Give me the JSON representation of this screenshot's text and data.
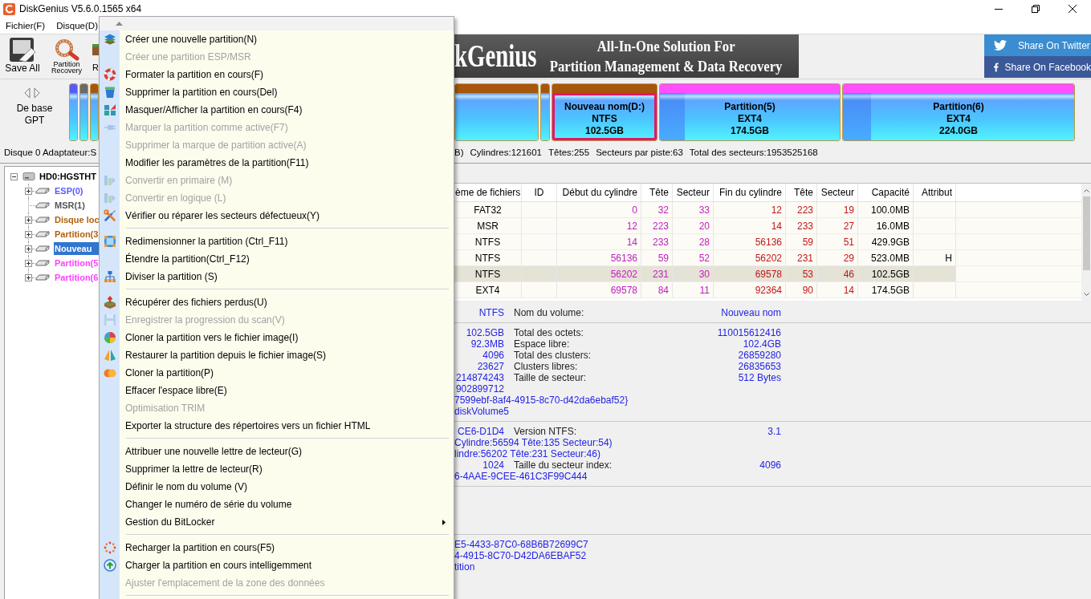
{
  "window": {
    "title": "DiskGenius V5.6.0.1565 x64"
  },
  "menu_bar": [
    "Fichier(F)",
    "Disque(D)"
  ],
  "toolbar": [
    "Save All",
    "Partition Recovery",
    "R"
  ],
  "banner": {
    "logo": "kGenius",
    "tagline": [
      "All-In-One Solution For",
      "Partition Management & Data Recovery"
    ]
  },
  "share_buttons": [
    "Share On Twitter",
    "Share On Facebook"
  ],
  "disk_map": {
    "disk_type": [
      "De base",
      "GPT"
    ],
    "partitions": [
      {
        "color": "#5a5af0",
        "selected": false
      },
      {
        "color": "#6a6a6a",
        "selected": false
      },
      {
        "color": "#a8560c",
        "selected": false
      },
      {
        "color": "#a8560c",
        "selected": false
      },
      {
        "color": "#a8560c",
        "selected": false
      },
      {
        "name": "Nouveau nom(D:)",
        "file_system": "NTFS",
        "size": "102.5GB",
        "color": "#a8560c",
        "selected": true
      },
      {
        "name": "Partition(5)",
        "file_system": "EXT4",
        "size": "174.5GB",
        "color": "#ff50ff",
        "selected": false,
        "level": 0.14
      },
      {
        "name": "Partition(6)",
        "file_system": "EXT4",
        "size": "224.0GB",
        "color": "#ff50ff",
        "selected": false,
        "level": 0.12
      }
    ]
  },
  "disk_info": [
    "Disque 0 Adaptateur:S",
    "B)",
    "Cylindres:121601",
    "Têtes:255",
    "Secteurs par piste:63",
    "Total des secteurs:1953525168"
  ],
  "tree": {
    "label": "HD0:HGSTHT",
    "expanded": true,
    "children": [
      {
        "label": "ESP(0)",
        "color": "#5a5aff",
        "expandable": true,
        "selected": false
      },
      {
        "label": "MSR(1)",
        "color": "#555555",
        "expandable": false,
        "selected": false
      },
      {
        "label": "Disque loc",
        "color": "#b4600a",
        "expandable": true,
        "selected": false
      },
      {
        "label": "Partition(3",
        "color": "#b4600a",
        "expandable": true,
        "selected": false
      },
      {
        "label": "Nouveau",
        "expandable": true,
        "selected": true
      },
      {
        "label": "Partition(5",
        "color": "#ff40ff",
        "expandable": true,
        "selected": false
      },
      {
        "label": "Partition(6",
        "color": "#ff40ff",
        "expandable": true,
        "selected": false
      }
    ]
  },
  "partition_table": {
    "columns": [
      "ème de fichiers",
      "ID",
      "Début du cylindre",
      "Tête",
      "Secteur",
      "Fin du cylindre",
      "Tête",
      "Secteur",
      "Capacité",
      "Attribut"
    ],
    "rows": [
      {
        "file_system": "FAT32",
        "start_cylinder": "0",
        "start_head": "32",
        "start_sector": "33",
        "end_cylinder": "12",
        "end_head": "223",
        "end_sector": "19",
        "capacity": "100.0MB",
        "selected": false
      },
      {
        "file_system": "MSR",
        "start_cylinder": "12",
        "start_head": "223",
        "start_sector": "20",
        "end_cylinder": "14",
        "end_head": "233",
        "end_sector": "27",
        "capacity": "16.0MB",
        "selected": false
      },
      {
        "file_system": "NTFS",
        "start_cylinder": "14",
        "start_head": "233",
        "start_sector": "28",
        "end_cylinder": "56136",
        "end_head": "59",
        "end_sector": "51",
        "capacity": "429.9GB",
        "selected": false
      },
      {
        "file_system": "NTFS",
        "start_cylinder": "56136",
        "start_head": "59",
        "start_sector": "52",
        "end_cylinder": "56202",
        "end_head": "231",
        "end_sector": "29",
        "capacity": "523.0MB",
        "attribute": "H",
        "selected": false
      },
      {
        "file_system": "NTFS",
        "start_cylinder": "56202",
        "start_head": "231",
        "start_sector": "30",
        "end_cylinder": "69578",
        "end_head": "53",
        "end_sector": "46",
        "capacity": "102.5GB",
        "selected": true
      },
      {
        "file_system": "EXT4",
        "start_cylinder": "69578",
        "start_head": "84",
        "start_sector": "11",
        "end_cylinder": "92364",
        "end_head": "90",
        "end_sector": "14",
        "capacity": "174.5GB",
        "selected": false
      }
    ]
  },
  "details": {
    "sections": [
      {
        "kind": "rows",
        "rows": [
          {
            "kind": "pair",
            "left_value": "NTFS",
            "label": "Nom du volume:",
            "value": "Nouveau nom"
          }
        ]
      },
      {
        "kind": "rows",
        "rows": [
          {
            "kind": "pair",
            "left_value": "102.5GB",
            "label": "Total des octets:",
            "value": "110015612416"
          },
          {
            "kind": "pair",
            "left_value": "92.3MB",
            "label": "Espace libre:",
            "value": "102.4GB"
          },
          {
            "kind": "pair",
            "left_value": "4096",
            "label": "Total des clusters:",
            "value": "26859280"
          },
          {
            "kind": "pair",
            "left_value": "23627",
            "label": "Clusters libres:",
            "value": "26835653"
          },
          {
            "kind": "pair",
            "left_value": "214874243",
            "label": "Taille de secteur:",
            "value": "512 Bytes"
          },
          {
            "kind": "pair",
            "left_value": "902899712"
          },
          {
            "kind": "line",
            "text": "7599ebf-8af4-4915-8c70-d42da6ebaf52}"
          },
          {
            "kind": "line",
            "text": "diskVolume5"
          }
        ]
      },
      {
        "kind": "rows",
        "rows": [
          {
            "kind": "pair",
            "left_value": "CE6-D1D4",
            "label": "Version NTFS:",
            "value": "3.1"
          },
          {
            "kind": "line",
            "text": "Cylindre:56594 Tête:135 Secteur:54)"
          },
          {
            "kind": "line",
            "text": "lindre:56202 Tête:231 Secteur:46)"
          },
          {
            "kind": "pair",
            "left_value": "1024",
            "label": "Taille du secteur index:",
            "value": "4096"
          },
          {
            "kind": "line",
            "text": "6-4AAE-9CEE-461C3F99C444"
          }
        ]
      },
      {
        "kind": "blank"
      },
      {
        "kind": "rows",
        "rows": [
          {
            "kind": "line",
            "text": "E5-4433-87C0-68B6B72699C7"
          },
          {
            "kind": "line",
            "text": "4-4915-8C70-D42DA6EBAF52"
          },
          {
            "kind": "line",
            "text": "tition"
          }
        ]
      }
    ]
  },
  "context_menu": {
    "groups": [
      {
        "items": [
          {
            "label": "Créer une nouvelle partition(N)",
            "disabled": false
          },
          {
            "label": "Créer une partition ESP/MSR",
            "disabled": true
          },
          {
            "label": "Formater la partition en cours(F)",
            "disabled": false
          },
          {
            "label": "Supprimer la partition en cours(Del)",
            "disabled": false
          },
          {
            "label": "Masquer/Afficher la partition en cours(F4)",
            "disabled": false
          },
          {
            "label": "Marquer la partition comme active(F7)",
            "disabled": true
          },
          {
            "label": "Supprimer la marque de partition active(A)",
            "disabled": true
          },
          {
            "label": "Modifier les paramètres de la partition(F11)",
            "disabled": false
          },
          {
            "label": "Convertir en primaire (M)",
            "disabled": true
          },
          {
            "label": "Convertir en logique (L)",
            "disabled": true
          },
          {
            "label": "Vérifier ou réparer les secteurs défectueux(Y)",
            "disabled": false
          }
        ]
      },
      {
        "items": [
          {
            "label": "Redimensionner la partition (Ctrl_F11)",
            "disabled": false
          },
          {
            "label": "Étendre la partition(Ctrl_F12)",
            "disabled": false
          },
          {
            "label": "Diviser la partition (S)",
            "disabled": false
          }
        ]
      },
      {
        "items": [
          {
            "label": "Récupérer des fichiers perdus(U)",
            "disabled": false
          },
          {
            "label": "Enregistrer la progression du scan(V)",
            "disabled": true
          },
          {
            "label": "Cloner la partition vers le fichier image(I)",
            "disabled": false
          },
          {
            "label": "Restaurer la partition depuis le fichier image(S)",
            "disabled": false
          },
          {
            "label": "Cloner la partition(P)",
            "disabled": false
          },
          {
            "label": "Effacer l'espace libre(E)",
            "disabled": false
          },
          {
            "label": "Optimisation TRIM",
            "disabled": true
          },
          {
            "label": "Exporter la structure des répertoires vers un fichier HTML",
            "disabled": false
          }
        ]
      },
      {
        "items": [
          {
            "label": "Attribuer une nouvelle lettre de lecteur(G)",
            "disabled": false
          },
          {
            "label": "Supprimer la lettre de lecteur(R)",
            "disabled": false
          },
          {
            "label": "Définir le nom du volume (V)",
            "disabled": false
          },
          {
            "label": "Changer le numéro de série du volume",
            "disabled": false
          },
          {
            "label": "Gestion du BitLocker",
            "disabled": false,
            "submenu": true
          }
        ]
      },
      {
        "items": [
          {
            "label": "Recharger la partition en cours(F5)",
            "disabled": false
          },
          {
            "label": "Charger la partition en cours intelligemment",
            "disabled": false
          },
          {
            "label": "Ajuster l'emplacement de la zone des données",
            "disabled": true
          }
        ]
      }
    ]
  }
}
